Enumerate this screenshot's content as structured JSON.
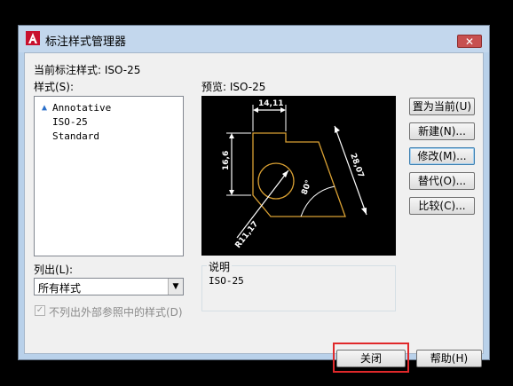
{
  "window": {
    "title": "标注样式管理器",
    "close_glyph": "✕"
  },
  "current_style": {
    "label": "当前标注样式: ISO-25"
  },
  "styles": {
    "label": "样式(S):",
    "items": [
      {
        "icon": "annotative-triangle-icon",
        "label": "Annotative"
      },
      {
        "icon": "",
        "label": "ISO-25"
      },
      {
        "icon": "",
        "label": "Standard"
      }
    ]
  },
  "preview": {
    "label": "预览: ISO-25",
    "dim_top": "14,11",
    "dim_left": "16,6",
    "dim_diag": "28,07",
    "dim_angle": "80°",
    "dim_radius": "R11,17"
  },
  "buttons": {
    "set_current": "置为当前(U)",
    "new": "新建(N)...",
    "modify": "修改(M)...",
    "override": "替代(O)...",
    "compare": "比较(C)...",
    "close": "关闭",
    "help": "帮助(H)"
  },
  "list_filter": {
    "label": "列出(L):",
    "value": "所有样式"
  },
  "checkbox": {
    "label": "不列出外部参照中的样式(D)",
    "checked": true,
    "mark": "✓"
  },
  "description": {
    "label": "说明",
    "text": "ISO-25"
  },
  "colors": {
    "preview_bg": "#000000",
    "preview_lines": "#ffffff",
    "preview_shape": "#d9a033",
    "highlight": "#e0282a"
  }
}
